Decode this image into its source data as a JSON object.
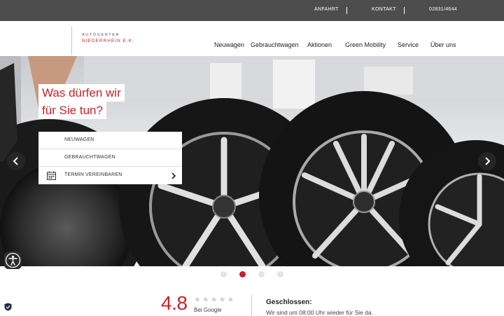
{
  "topbar": {
    "links": [
      "ANFAHRT",
      "KONTAKT",
      "02831/4644"
    ]
  },
  "logo": {
    "line1": "AUTOGENTER",
    "line2": "NIEDERRHEIN E.K."
  },
  "nav": {
    "items": [
      "Neuwagen",
      "Gebrauchtwagen",
      "Aktionen",
      "Green Mobility",
      "Service",
      "Über uns"
    ]
  },
  "hero": {
    "headline_line1": "Was dürfen wir",
    "headline_line2": "für Sie tun?",
    "menu": [
      "NEUWAGEN",
      "GEBRAUCHTWAGEN",
      "TERMIN VEREINBAREN"
    ],
    "slide_count": 4,
    "active_slide": 2
  },
  "reviews": {
    "score": "4.8",
    "stars": "★★★★★",
    "source": "Bei Google"
  },
  "hours": {
    "status": "Geschlossen:",
    "note": "Wir sind um 08:00 Uhr wieder für Sie da."
  },
  "colors": {
    "brand_red": "#cc1f27",
    "topbar": "#4d4d4d"
  }
}
